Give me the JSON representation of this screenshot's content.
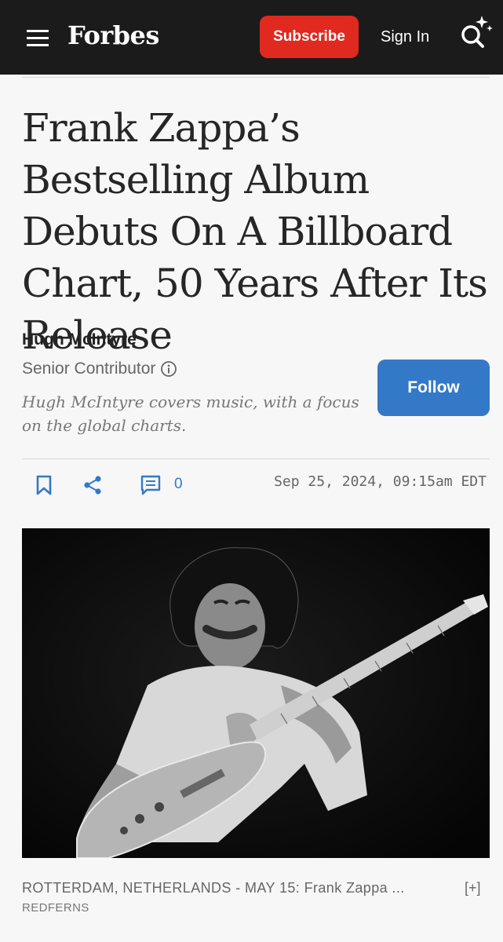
{
  "header": {
    "logo": "Forbes",
    "subscribe_label": "Subscribe",
    "signin_label": "Sign In"
  },
  "article": {
    "headline": "Frank Zappa’s Bestselling Album Debuts On A Billboard Chart, 50 Years After Its Release",
    "author": {
      "name": "Hugh McIntyre",
      "role": "Senior Contributor",
      "bio": "Hugh McIntyre covers music, with a focus on the global charts.",
      "follow_label": "Follow"
    },
    "actions": {
      "comment_count": "0"
    },
    "date": "Sep 25, 2024, 09:15am EDT",
    "image": {
      "caption": "ROTTERDAM, NETHERLANDS - MAY 15: Frank Zappa ...",
      "expand_label": "[+]",
      "credit": "REDFERNS"
    }
  },
  "colors": {
    "header_bg": "#1b1b1b",
    "subscribe": "#e0291f",
    "accent_blue": "#3479c7"
  }
}
